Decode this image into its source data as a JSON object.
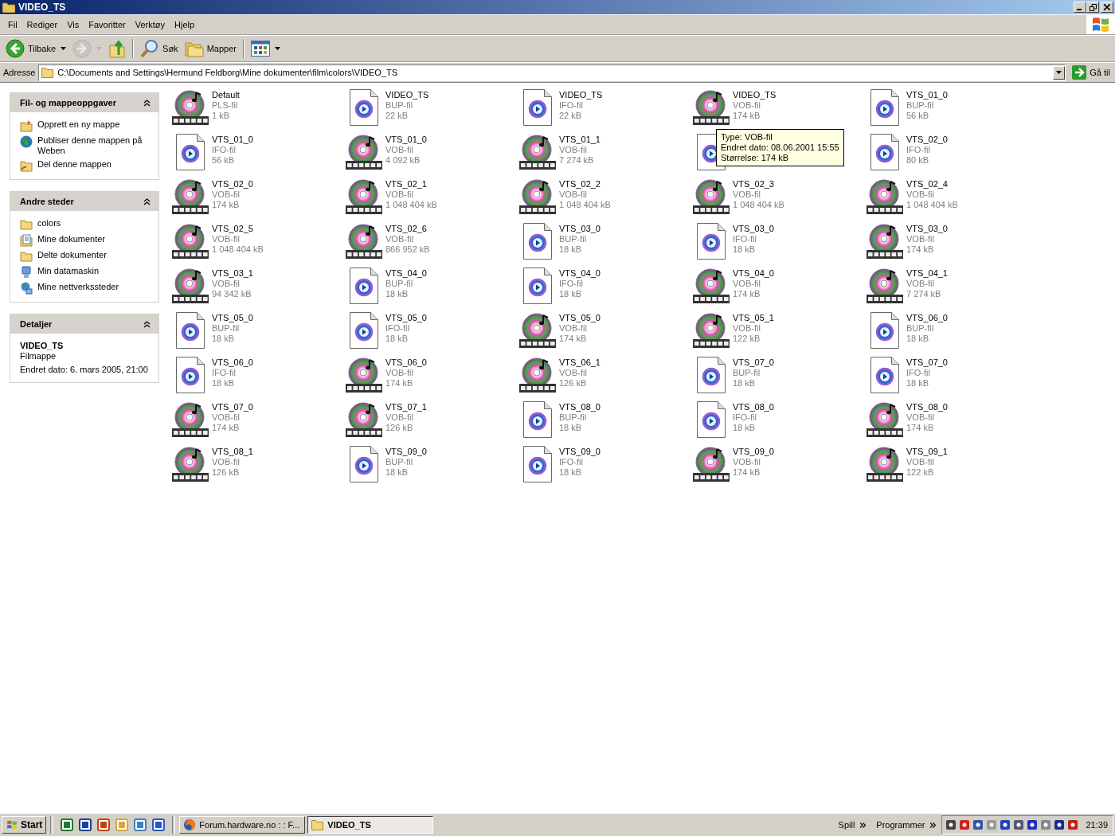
{
  "window": {
    "title": "VIDEO_TS"
  },
  "menu": [
    "Fil",
    "Rediger",
    "Vis",
    "Favoritter",
    "Verktøy",
    "Hjelp"
  ],
  "toolbar": [
    {
      "kind": "back",
      "label": "Tilbake",
      "disabled": false
    },
    {
      "kind": "forward",
      "disabled": true
    },
    {
      "kind": "up",
      "disabled": false
    },
    {
      "kind": "search",
      "label": "Søk",
      "disabled": false
    },
    {
      "kind": "folders",
      "label": "Mapper",
      "disabled": false
    },
    {
      "kind": "views",
      "disabled": false
    }
  ],
  "address": {
    "label": "Adresse",
    "value": "C:\\Documents and Settings\\Hermund Feldborg\\Mine dokumenter\\film\\colors\\VIDEO_TS",
    "go_label": "Gå til"
  },
  "sidebar": [
    {
      "kind": "links",
      "title": "Fil- og mappeoppgaver",
      "items": [
        {
          "label": "Opprett en ny mappe"
        },
        {
          "label": "Publiser denne mappen på Weben"
        },
        {
          "label": "Del denne mappen"
        }
      ]
    },
    {
      "kind": "links",
      "title": "Andre steder",
      "items": [
        {
          "label": "colors"
        },
        {
          "label": "Mine dokumenter"
        },
        {
          "label": "Delte dokumenter"
        },
        {
          "label": "Min datamaskin"
        },
        {
          "label": "Mine nettverkssteder"
        }
      ]
    },
    {
      "kind": "details",
      "title": "Detaljer",
      "name": "VIDEO_TS",
      "type": "Filmappe",
      "modified": "Endret dato: 6. mars 2005, 21:00"
    }
  ],
  "files": [
    {
      "kind": "video",
      "name": "Default",
      "type": "PLS-fil",
      "size": "1 kB"
    },
    {
      "kind": "document",
      "name": "VIDEO_TS",
      "type": "BUP-fil",
      "size": "22 kB"
    },
    {
      "kind": "document",
      "name": "VIDEO_TS",
      "type": "IFO-fil",
      "size": "22 kB"
    },
    {
      "kind": "video",
      "name": "VIDEO_TS",
      "type": "VOB-fil",
      "size": "174 kB"
    },
    {
      "kind": "document",
      "name": "VTS_01_0",
      "type": "BUP-fil",
      "size": "56 kB"
    },
    {
      "kind": "document",
      "name": "VTS_01_0",
      "type": "IFO-fil",
      "size": "56 kB"
    },
    {
      "kind": "video",
      "name": "VTS_01_0",
      "type": "VOB-fil",
      "size": "4 092 kB"
    },
    {
      "kind": "video",
      "name": "VTS_01_1",
      "type": "VOB-fil",
      "size": "7 274 kB"
    },
    {
      "kind": "document",
      "tooltip": [
        "Type: VOB-fil",
        "Endret dato: 08.06.2001 15:55",
        "Størrelse: 174 kB"
      ]
    },
    {
      "kind": "document",
      "name": "VTS_02_0",
      "type": "IFO-fil",
      "size": "80 kB"
    },
    {
      "kind": "video",
      "name": "VTS_02_0",
      "type": "VOB-fil",
      "size": "174 kB"
    },
    {
      "kind": "video",
      "name": "VTS_02_1",
      "type": "VOB-fil",
      "size": "1 048 404 kB"
    },
    {
      "kind": "video",
      "name": "VTS_02_2",
      "type": "VOB-fil",
      "size": "1 048 404 kB"
    },
    {
      "kind": "video",
      "name": "VTS_02_3",
      "type": "VOB-fil",
      "size": "1 048 404 kB"
    },
    {
      "kind": "video",
      "name": "VTS_02_4",
      "type": "VOB-fil",
      "size": "1 048 404 kB"
    },
    {
      "kind": "video",
      "name": "VTS_02_5",
      "type": "VOB-fil",
      "size": "1 048 404 kB"
    },
    {
      "kind": "video",
      "name": "VTS_02_6",
      "type": "VOB-fil",
      "size": "866 952 kB"
    },
    {
      "kind": "document",
      "name": "VTS_03_0",
      "type": "BUP-fil",
      "size": "18 kB"
    },
    {
      "kind": "document",
      "name": "VTS_03_0",
      "type": "IFO-fil",
      "size": "18 kB"
    },
    {
      "kind": "video",
      "name": "VTS_03_0",
      "type": "VOB-fil",
      "size": "174 kB"
    },
    {
      "kind": "video",
      "name": "VTS_03_1",
      "type": "VOB-fil",
      "size": "94 342 kB"
    },
    {
      "kind": "document",
      "name": "VTS_04_0",
      "type": "BUP-fil",
      "size": "18 kB"
    },
    {
      "kind": "document",
      "name": "VTS_04_0",
      "type": "IFO-fil",
      "size": "18 kB"
    },
    {
      "kind": "video",
      "name": "VTS_04_0",
      "type": "VOB-fil",
      "size": "174 kB"
    },
    {
      "kind": "video",
      "name": "VTS_04_1",
      "type": "VOB-fil",
      "size": "7 274 kB"
    },
    {
      "kind": "document",
      "name": "VTS_05_0",
      "type": "BUP-fil",
      "size": "18 kB"
    },
    {
      "kind": "document",
      "name": "VTS_05_0",
      "type": "IFO-fil",
      "size": "18 kB"
    },
    {
      "kind": "video",
      "name": "VTS_05_0",
      "type": "VOB-fil",
      "size": "174 kB"
    },
    {
      "kind": "video",
      "name": "VTS_05_1",
      "type": "VOB-fil",
      "size": "122 kB"
    },
    {
      "kind": "document",
      "name": "VTS_06_0",
      "type": "BUP-fil",
      "size": "18 kB"
    },
    {
      "kind": "document",
      "name": "VTS_06_0",
      "type": "IFO-fil",
      "size": "18 kB"
    },
    {
      "kind": "video",
      "name": "VTS_06_0",
      "type": "VOB-fil",
      "size": "174 kB"
    },
    {
      "kind": "video",
      "name": "VTS_06_1",
      "type": "VOB-fil",
      "size": "126 kB"
    },
    {
      "kind": "document",
      "name": "VTS_07_0",
      "type": "BUP-fil",
      "size": "18 kB"
    },
    {
      "kind": "document",
      "name": "VTS_07_0",
      "type": "IFO-fil",
      "size": "18 kB"
    },
    {
      "kind": "video",
      "name": "VTS_07_0",
      "type": "VOB-fil",
      "size": "174 kB"
    },
    {
      "kind": "video",
      "name": "VTS_07_1",
      "type": "VOB-fil",
      "size": "126 kB"
    },
    {
      "kind": "document",
      "name": "VTS_08_0",
      "type": "BUP-fil",
      "size": "18 kB"
    },
    {
      "kind": "document",
      "name": "VTS_08_0",
      "type": "IFO-fil",
      "size": "18 kB"
    },
    {
      "kind": "video",
      "name": "VTS_08_0",
      "type": "VOB-fil",
      "size": "174 kB"
    },
    {
      "kind": "video",
      "name": "VTS_08_1",
      "type": "VOB-fil",
      "size": "126 kB"
    },
    {
      "kind": "document",
      "name": "VTS_09_0",
      "type": "BUP-fil",
      "size": "18 kB"
    },
    {
      "kind": "document",
      "name": "VTS_09_0",
      "type": "IFO-fil",
      "size": "18 kB"
    },
    {
      "kind": "video",
      "name": "VTS_09_0",
      "type": "VOB-fil",
      "size": "174 kB"
    },
    {
      "kind": "video",
      "name": "VTS_09_1",
      "type": "VOB-fil",
      "size": "122 kB"
    }
  ],
  "taskbar": {
    "start_label": "Start",
    "tasks": [
      {
        "label": "Forum.hardware.no : : F...",
        "selected": false
      },
      {
        "label": "VIDEO_TS",
        "selected": true
      }
    ],
    "toolbars": [
      "Spill",
      "Programmer"
    ],
    "clock": "21:39"
  }
}
